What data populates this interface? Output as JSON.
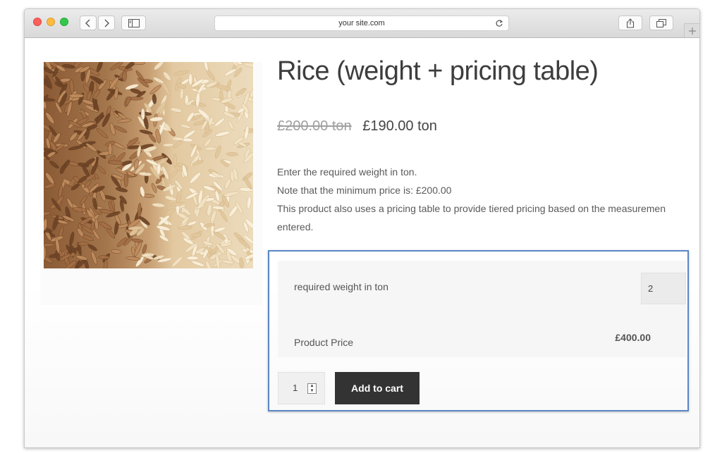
{
  "browser": {
    "url": "your site.com",
    "icons": {
      "back": "chevron-left-icon",
      "forward": "chevron-right-icon",
      "sidebar": "sidebar-icon",
      "reload": "reload-icon",
      "share": "share-icon",
      "tabs": "tabs-icon",
      "new_tab": "plus-icon"
    }
  },
  "product": {
    "title": "Rice (weight + pricing table)",
    "regular_price": "£200.00 ton",
    "sale_price": "£190.00 ton",
    "description": [
      "Enter the required weight in ton.",
      "Note that the minimum price is: £200.00",
      "This product also uses a pricing table to provide tiered pricing based on the measuremen",
      "entered."
    ]
  },
  "calculator": {
    "weight_label": "required weight in ton",
    "weight_value": "2",
    "price_label": "Product Price",
    "price_value": "£400.00"
  },
  "cart": {
    "quantity": "1",
    "add_to_cart": "Add to cart"
  },
  "colors": {
    "highlight_border": "#5b86c8",
    "button_bg": "#333333"
  }
}
